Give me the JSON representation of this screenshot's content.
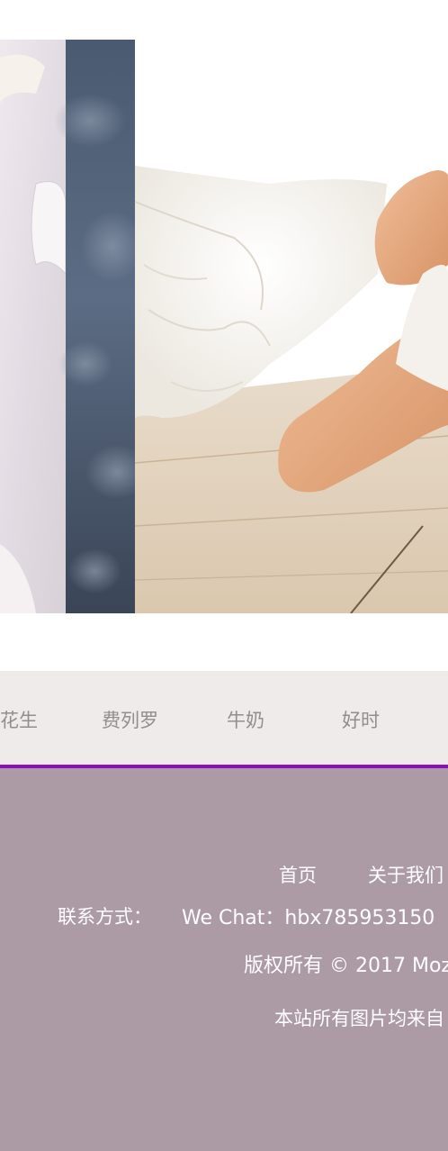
{
  "brands": [
    "花生",
    "费列罗",
    "牛奶",
    "好时"
  ],
  "footer": {
    "nav": [
      "首页",
      "关于我们"
    ],
    "contact_label": "联系方式：",
    "wechat": "We Chat：hbx785953150",
    "copyright": "版权所有 © 2017 Moz",
    "disclaimer": "本站所有图片均来自"
  },
  "colors": {
    "brand_bar_bg": "#efebea",
    "accent_line": "#8a12b8",
    "footer_bg": "#ac9aa5"
  }
}
